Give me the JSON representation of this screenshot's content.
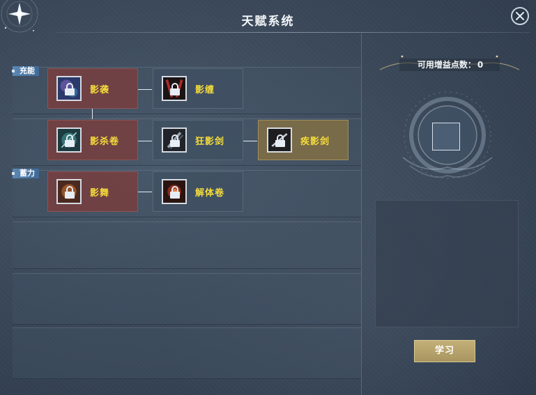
{
  "window": {
    "title": "天赋系统",
    "close_icon": "close-icon"
  },
  "categories": [
    {
      "label": "充能"
    },
    {
      "label": "蓄力"
    }
  ],
  "talents": [
    {
      "name": "影袭",
      "tier": "red",
      "locked": true
    },
    {
      "name": "影缠",
      "tier": "blue",
      "locked": true
    },
    {
      "name": "影杀卷",
      "tier": "red",
      "locked": true
    },
    {
      "name": "狂影剑",
      "tier": "blue",
      "locked": true
    },
    {
      "name": "疾影剑",
      "tier": "gold",
      "locked": true
    },
    {
      "name": "影舞",
      "tier": "red",
      "locked": true
    },
    {
      "name": "解体卷",
      "tier": "blue",
      "locked": true
    }
  ],
  "side": {
    "points_label": "可用增益点数：",
    "points_value": "0",
    "learn_button": "学习"
  },
  "colors": {
    "talent_name": "#f5dc3c",
    "tier_red": "#7a3e3e",
    "tier_blue": "#405062",
    "tier_gold": "#7e6e46",
    "category_tag": "#4f7aa8",
    "learn_button": "#b5a26c"
  }
}
